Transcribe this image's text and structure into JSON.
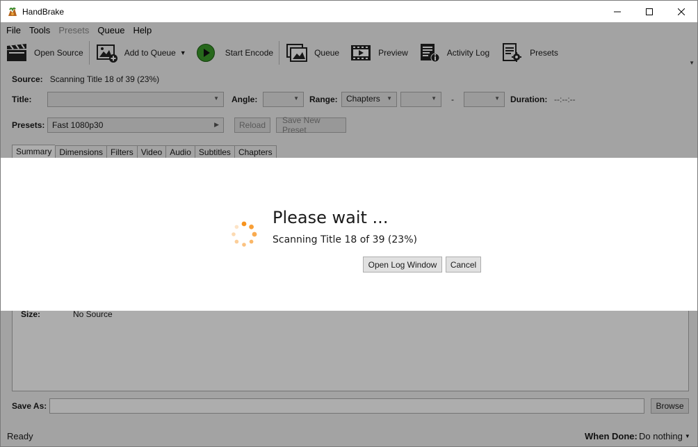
{
  "window": {
    "title": "HandBrake"
  },
  "menu": [
    {
      "label": "File",
      "enabled": true
    },
    {
      "label": "Tools",
      "enabled": true
    },
    {
      "label": "Presets",
      "enabled": false
    },
    {
      "label": "Queue",
      "enabled": true
    },
    {
      "label": "Help",
      "enabled": true
    }
  ],
  "toolbar": {
    "open_source": "Open Source",
    "add_to_queue": "Add to Queue",
    "start_encode": "Start Encode",
    "queue": "Queue",
    "preview": "Preview",
    "activity_log": "Activity Log",
    "presets": "Presets"
  },
  "source": {
    "label": "Source:",
    "value": "Scanning Title 18 of 39 (23%)"
  },
  "title_row": {
    "title_label": "Title:",
    "angle_label": "Angle:",
    "range_label": "Range:",
    "range_value": "Chapters",
    "range_dash": "-",
    "duration_label": "Duration:",
    "duration_value": "--:--:--"
  },
  "presets_row": {
    "label": "Presets:",
    "value": "Fast 1080p30",
    "reload": "Reload",
    "save_new": "Save New Preset"
  },
  "tabs": [
    "Summary",
    "Dimensions",
    "Filters",
    "Video",
    "Audio",
    "Subtitles",
    "Chapters"
  ],
  "summary": {
    "size_label": "Size:",
    "size_value": "No Source"
  },
  "save_as": {
    "label": "Save As:",
    "browse": "Browse"
  },
  "status": {
    "text": "Ready",
    "when_done_label": "When Done:",
    "when_done_value": "Do nothing"
  },
  "modal": {
    "title": "Please wait ...",
    "message": "Scanning Title 18 of 39 (23%)",
    "open_log": "Open Log Window",
    "cancel": "Cancel"
  },
  "colors": {
    "spinner": "#f7931e",
    "play": "#3a9a2a"
  }
}
